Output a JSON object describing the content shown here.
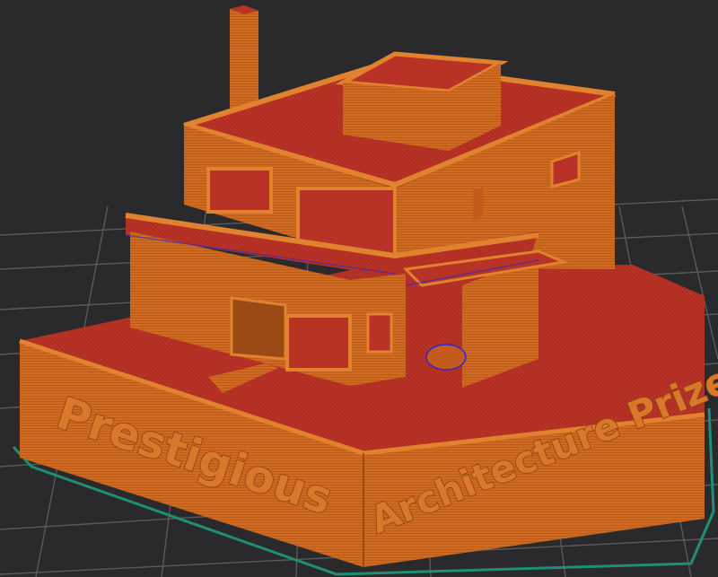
{
  "viewport": {
    "background_color": "#2a2a2c",
    "grid_color": "#5a5a5e",
    "bed_outline_color": "#1f8f73"
  },
  "model": {
    "body_color": "#d06a20",
    "top_surface_color": "#b83226",
    "base_text": {
      "left": "Prestigious",
      "right": "Architecture Prize"
    }
  }
}
